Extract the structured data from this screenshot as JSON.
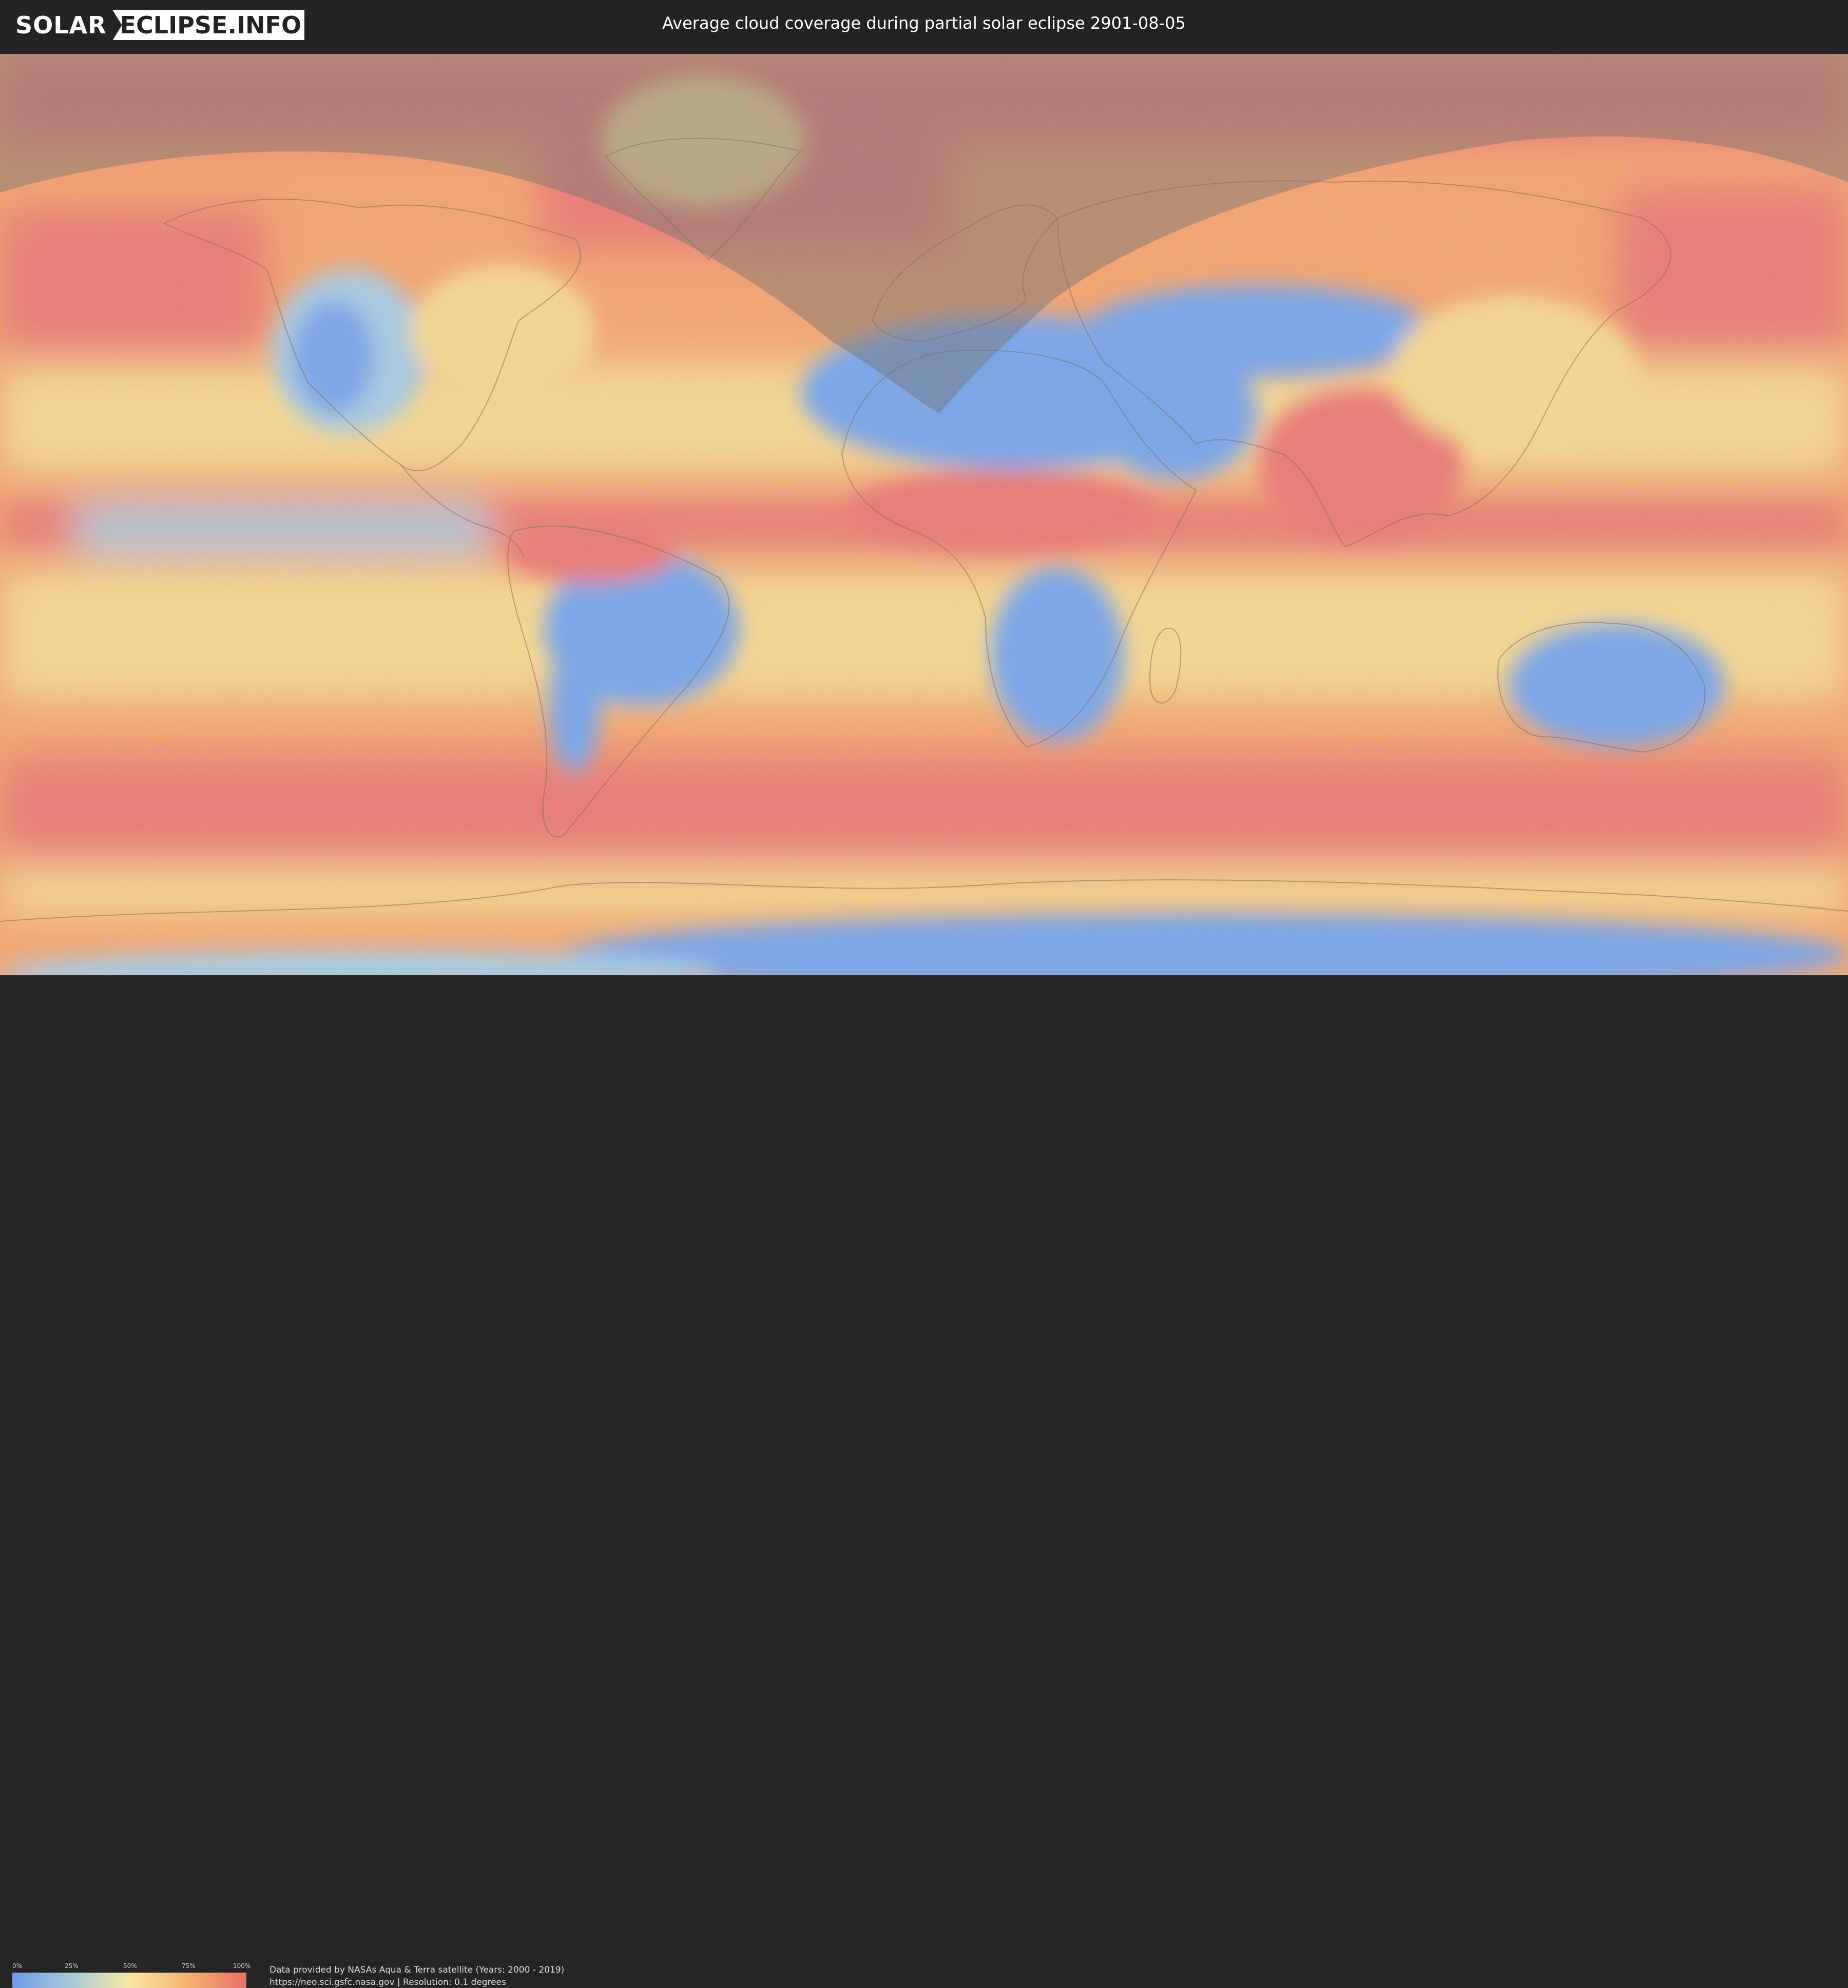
{
  "header": {
    "logo_left": "SOLAR",
    "logo_right": "ECLIPSE.INFO",
    "title": "Average cloud coverage during partial solar eclipse 2901-08-05"
  },
  "legend": {
    "labels": [
      "0%",
      "25%",
      "50%",
      "75%",
      "100%"
    ],
    "colors": [
      "#6f9bea",
      "#a7c9d8",
      "#f6e7a3",
      "#f4b36f",
      "#e8706d"
    ]
  },
  "footer": {
    "line1": "Data provided by NASAs Aqua & Terra satellite (Years: 2000 - 2019)",
    "line2": "https://neo.sci.gsfc.nasa.gov | Resolution: 0.1 degrees"
  },
  "map": {
    "palette": {
      "clear": "#7aa5e8",
      "light": "#a9cbe0",
      "medium": "#f4d690",
      "heavy": "#f3a46f",
      "overcast": "#ea7b74",
      "borders": "#7d6a5a",
      "shadow": "#6e6e6e"
    }
  }
}
